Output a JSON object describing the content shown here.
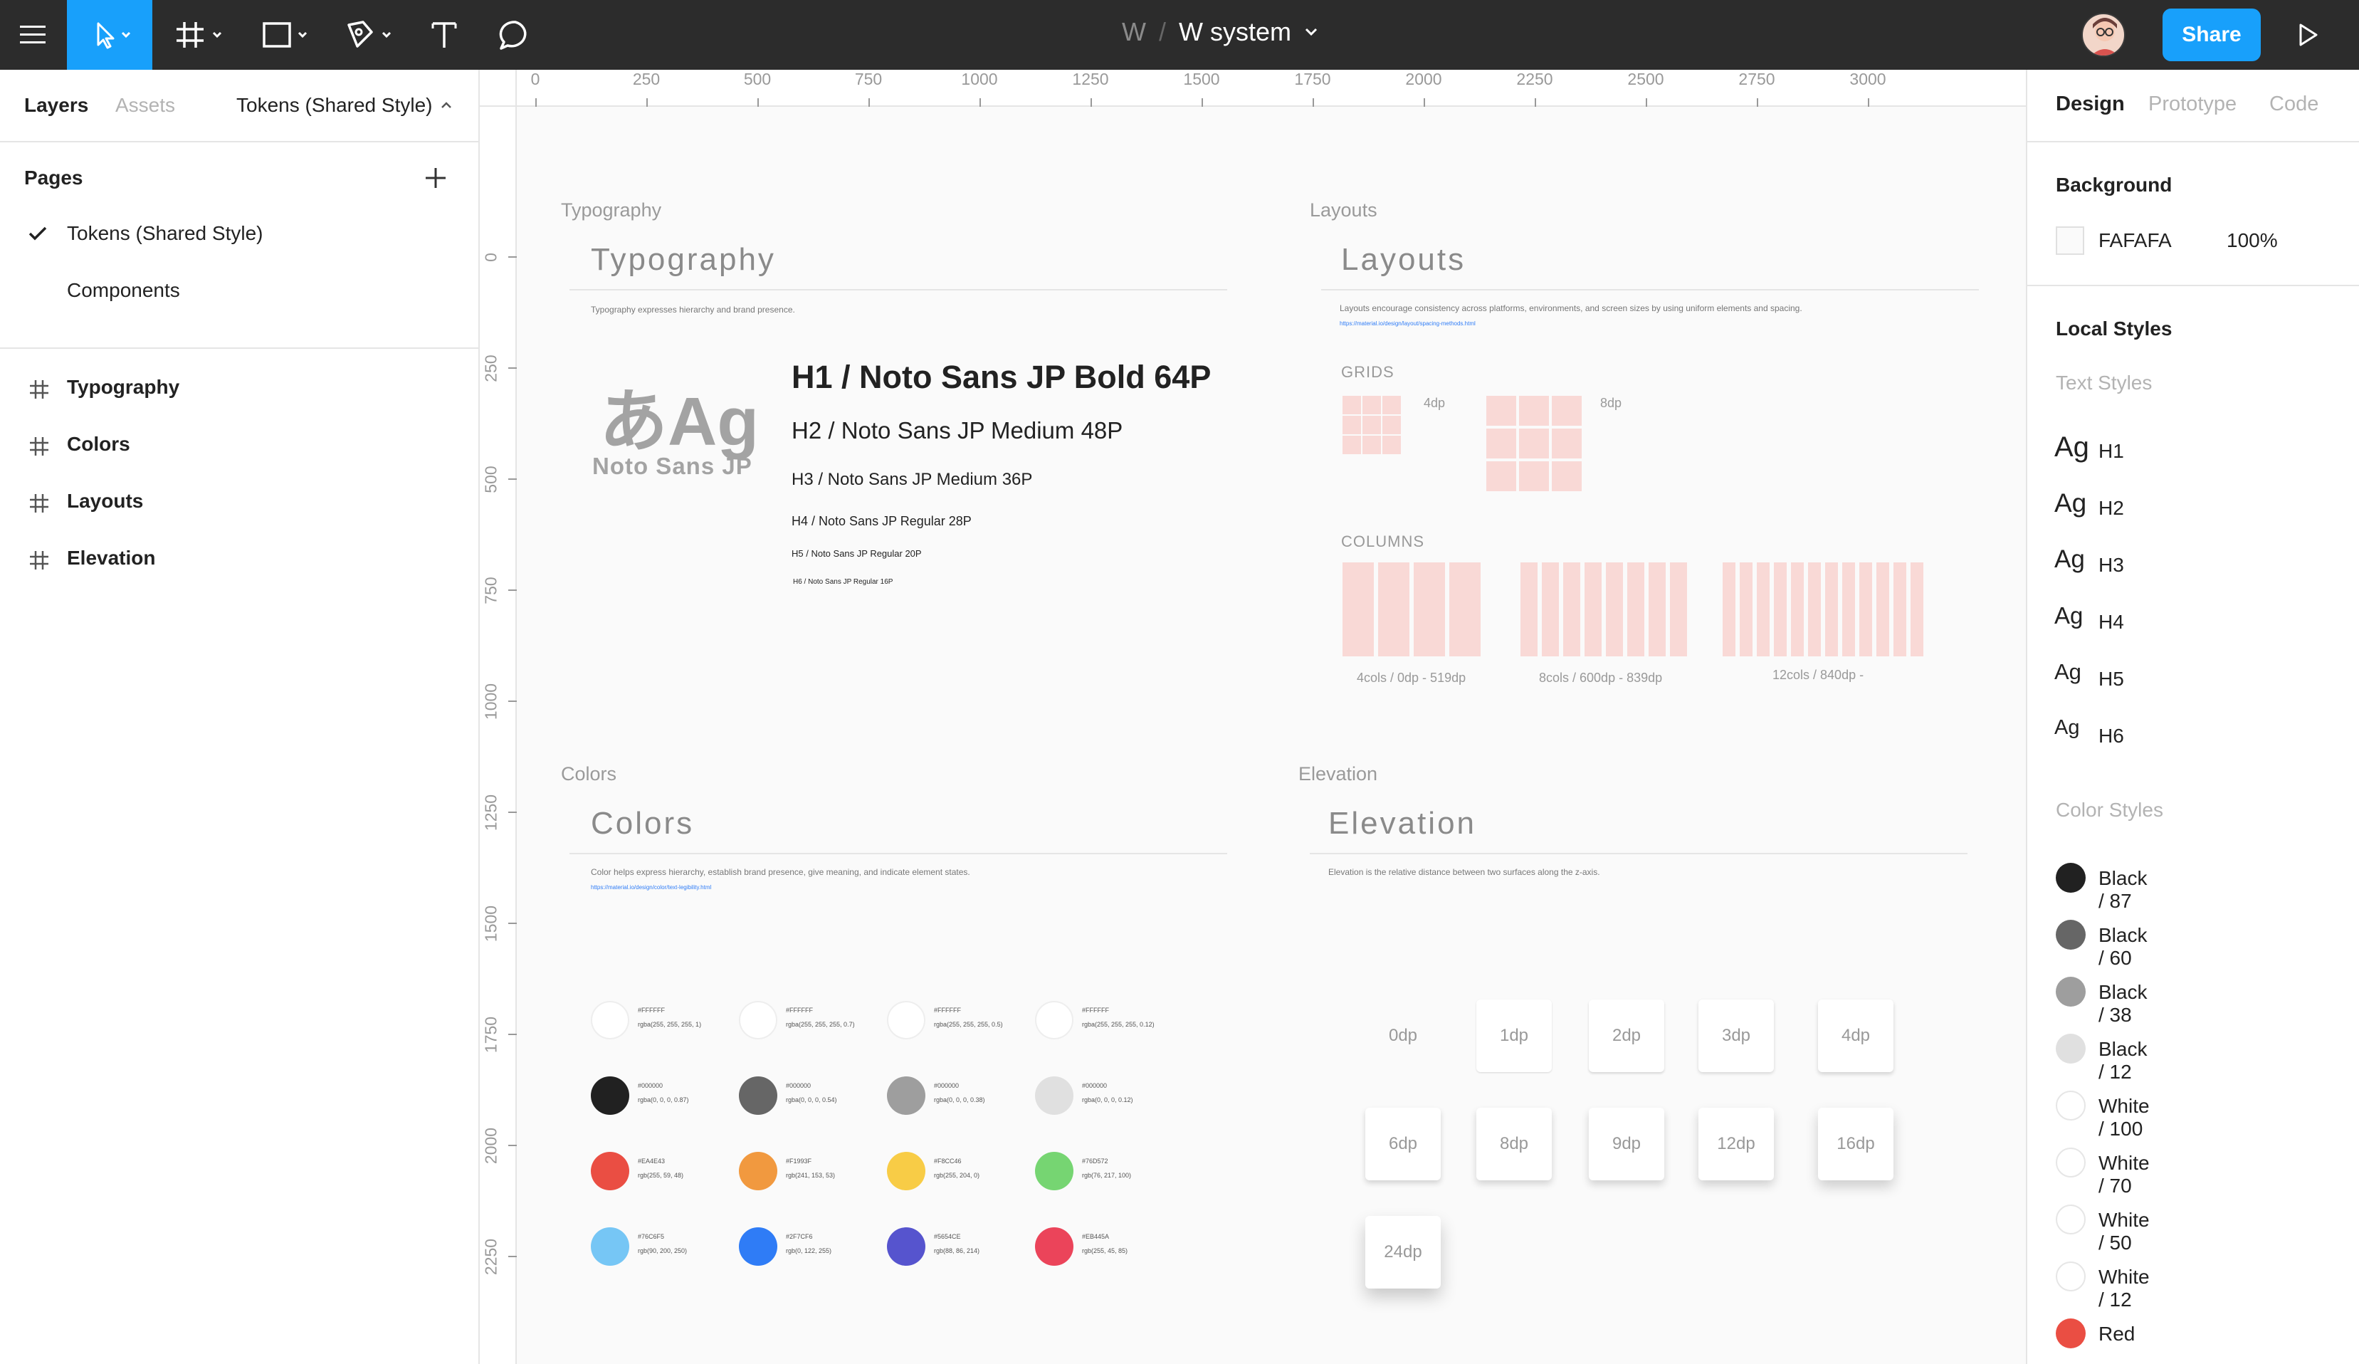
{
  "toolbar": {
    "team": "W",
    "separator": "/",
    "file_name": "W system",
    "share_label": "Share",
    "accent_color": "#18a0fb"
  },
  "left_panel": {
    "tabs": {
      "layers": "Layers",
      "assets": "Assets"
    },
    "current_page": "Tokens (Shared Style)",
    "pages_heading": "Pages",
    "pages": [
      {
        "label": "Tokens (Shared Style)",
        "selected": true
      },
      {
        "label": "Components",
        "selected": false
      }
    ],
    "frames": [
      "Typography",
      "Colors",
      "Layouts",
      "Elevation"
    ]
  },
  "rulers": {
    "horizontal": [
      "0",
      "250",
      "500",
      "750",
      "1000",
      "1250",
      "1500",
      "1750",
      "2000",
      "2250",
      "2500",
      "2750",
      "3000"
    ],
    "vertical": [
      "0",
      "250",
      "500",
      "750",
      "1000",
      "1250",
      "1500",
      "1750",
      "2000",
      "2250"
    ]
  },
  "canvas": {
    "typography": {
      "frame_label": "Typography",
      "title": "Typography",
      "description": "Typography expresses hierarchy and brand presence.",
      "sample_glyph": "あAg",
      "font_name": "Noto Sans JP",
      "styles": [
        "H1 / Noto Sans JP Bold 64P",
        "H2 / Noto Sans JP Medium 48P",
        "H3 / Noto Sans JP Medium 36P",
        "H4 / Noto Sans JP Regular 28P",
        "H5 / Noto Sans JP Regular 20P",
        "H6 / Noto Sans JP Regular 16P"
      ]
    },
    "layouts": {
      "frame_label": "Layouts",
      "title": "Layouts",
      "description": "Layouts encourage consistency across platforms, environments, and screen sizes by using uniform elements and spacing.",
      "link": "https://material.io/design/layout/spacing-methods.html",
      "grids_heading": "GRIDS",
      "grid_labels": [
        "4dp",
        "8dp"
      ],
      "columns_heading": "COLUMNS",
      "column_labels": [
        "4cols / 0dp - 519dp",
        "8cols / 600dp - 839dp",
        "12cols / 840dp -"
      ]
    },
    "colors": {
      "frame_label": "Colors",
      "title": "Colors",
      "description": "Color helps express hierarchy, establish brand presence, give meaning, and indicate element states.",
      "link": "https://material.io/design/color/text-legibility.html",
      "swatches": [
        [
          {
            "hex": "#FFFFFF",
            "value": "rgba(255, 255, 255, 1)",
            "color": "#ffffff"
          },
          {
            "hex": "#FFFFFF",
            "value": "rgba(255, 255, 255, 0.7)",
            "color": "#ffffff"
          },
          {
            "hex": "#FFFFFF",
            "value": "rgba(255, 255, 255, 0.5)",
            "color": "#ffffff"
          },
          {
            "hex": "#FFFFFF",
            "value": "rgba(255, 255, 255, 0.12)",
            "color": "#ffffff"
          }
        ],
        [
          {
            "hex": "#000000",
            "value": "rgba(0, 0, 0, 0.87)",
            "color": "#212121"
          },
          {
            "hex": "#000000",
            "value": "rgba(0, 0, 0, 0.54)",
            "color": "#666666"
          },
          {
            "hex": "#000000",
            "value": "rgba(0, 0, 0, 0.38)",
            "color": "#9e9e9e"
          },
          {
            "hex": "#000000",
            "value": "rgba(0, 0, 0, 0.12)",
            "color": "#e0e0e0"
          }
        ],
        [
          {
            "hex": "#EA4E43",
            "value": "rgb(255, 59, 48)",
            "color": "#ea4e43"
          },
          {
            "hex": "#F1993F",
            "value": "rgb(241, 153, 53)",
            "color": "#f1993f"
          },
          {
            "hex": "#F8CC46",
            "value": "rgb(255, 204, 0)",
            "color": "#f8cc46"
          },
          {
            "hex": "#76D572",
            "value": "rgb(76, 217, 100)",
            "color": "#76d572"
          }
        ],
        [
          {
            "hex": "#76C6F5",
            "value": "rgb(90, 200, 250)",
            "color": "#76c6f5"
          },
          {
            "hex": "#2F7CF6",
            "value": "rgb(0, 122, 255)",
            "color": "#2f7cf6"
          },
          {
            "hex": "#5654CE",
            "value": "rgb(88, 86, 214)",
            "color": "#5654ce"
          },
          {
            "hex": "#EB445A",
            "value": "rgb(255, 45, 85)",
            "color": "#eb445a"
          }
        ]
      ]
    },
    "elevation": {
      "frame_label": "Elevation",
      "title": "Elevation",
      "description": "Elevation is the relative distance between two surfaces along the z-axis.",
      "levels": [
        "0dp",
        "1dp",
        "2dp",
        "3dp",
        "4dp",
        "6dp",
        "8dp",
        "9dp",
        "12dp",
        "16dp",
        "24dp"
      ]
    }
  },
  "right_panel": {
    "tabs": {
      "design": "Design",
      "prototype": "Prototype",
      "code": "Code"
    },
    "background_heading": "Background",
    "background_hex": "FAFAFA",
    "background_opacity": "100%",
    "local_styles_heading": "Local Styles",
    "text_styles_heading": "Text Styles",
    "text_style_sample": "Ag",
    "text_styles": [
      "H1",
      "H2",
      "H3",
      "H4",
      "H5",
      "H6"
    ],
    "color_styles_heading": "Color Styles",
    "color_styles": [
      {
        "name": "Black / 87",
        "color": "#212121"
      },
      {
        "name": "Black / 60",
        "color": "#666666"
      },
      {
        "name": "Black / 38",
        "color": "#9e9e9e"
      },
      {
        "name": "Black / 12",
        "color": "#e0e0e0"
      },
      {
        "name": "White / 100",
        "color": "#ffffff"
      },
      {
        "name": "White / 70",
        "color": "#ffffff"
      },
      {
        "name": "White / 50",
        "color": "#ffffff"
      },
      {
        "name": "White / 12",
        "color": "#ffffff"
      },
      {
        "name": "Red",
        "color": "#ea4e43"
      }
    ]
  }
}
